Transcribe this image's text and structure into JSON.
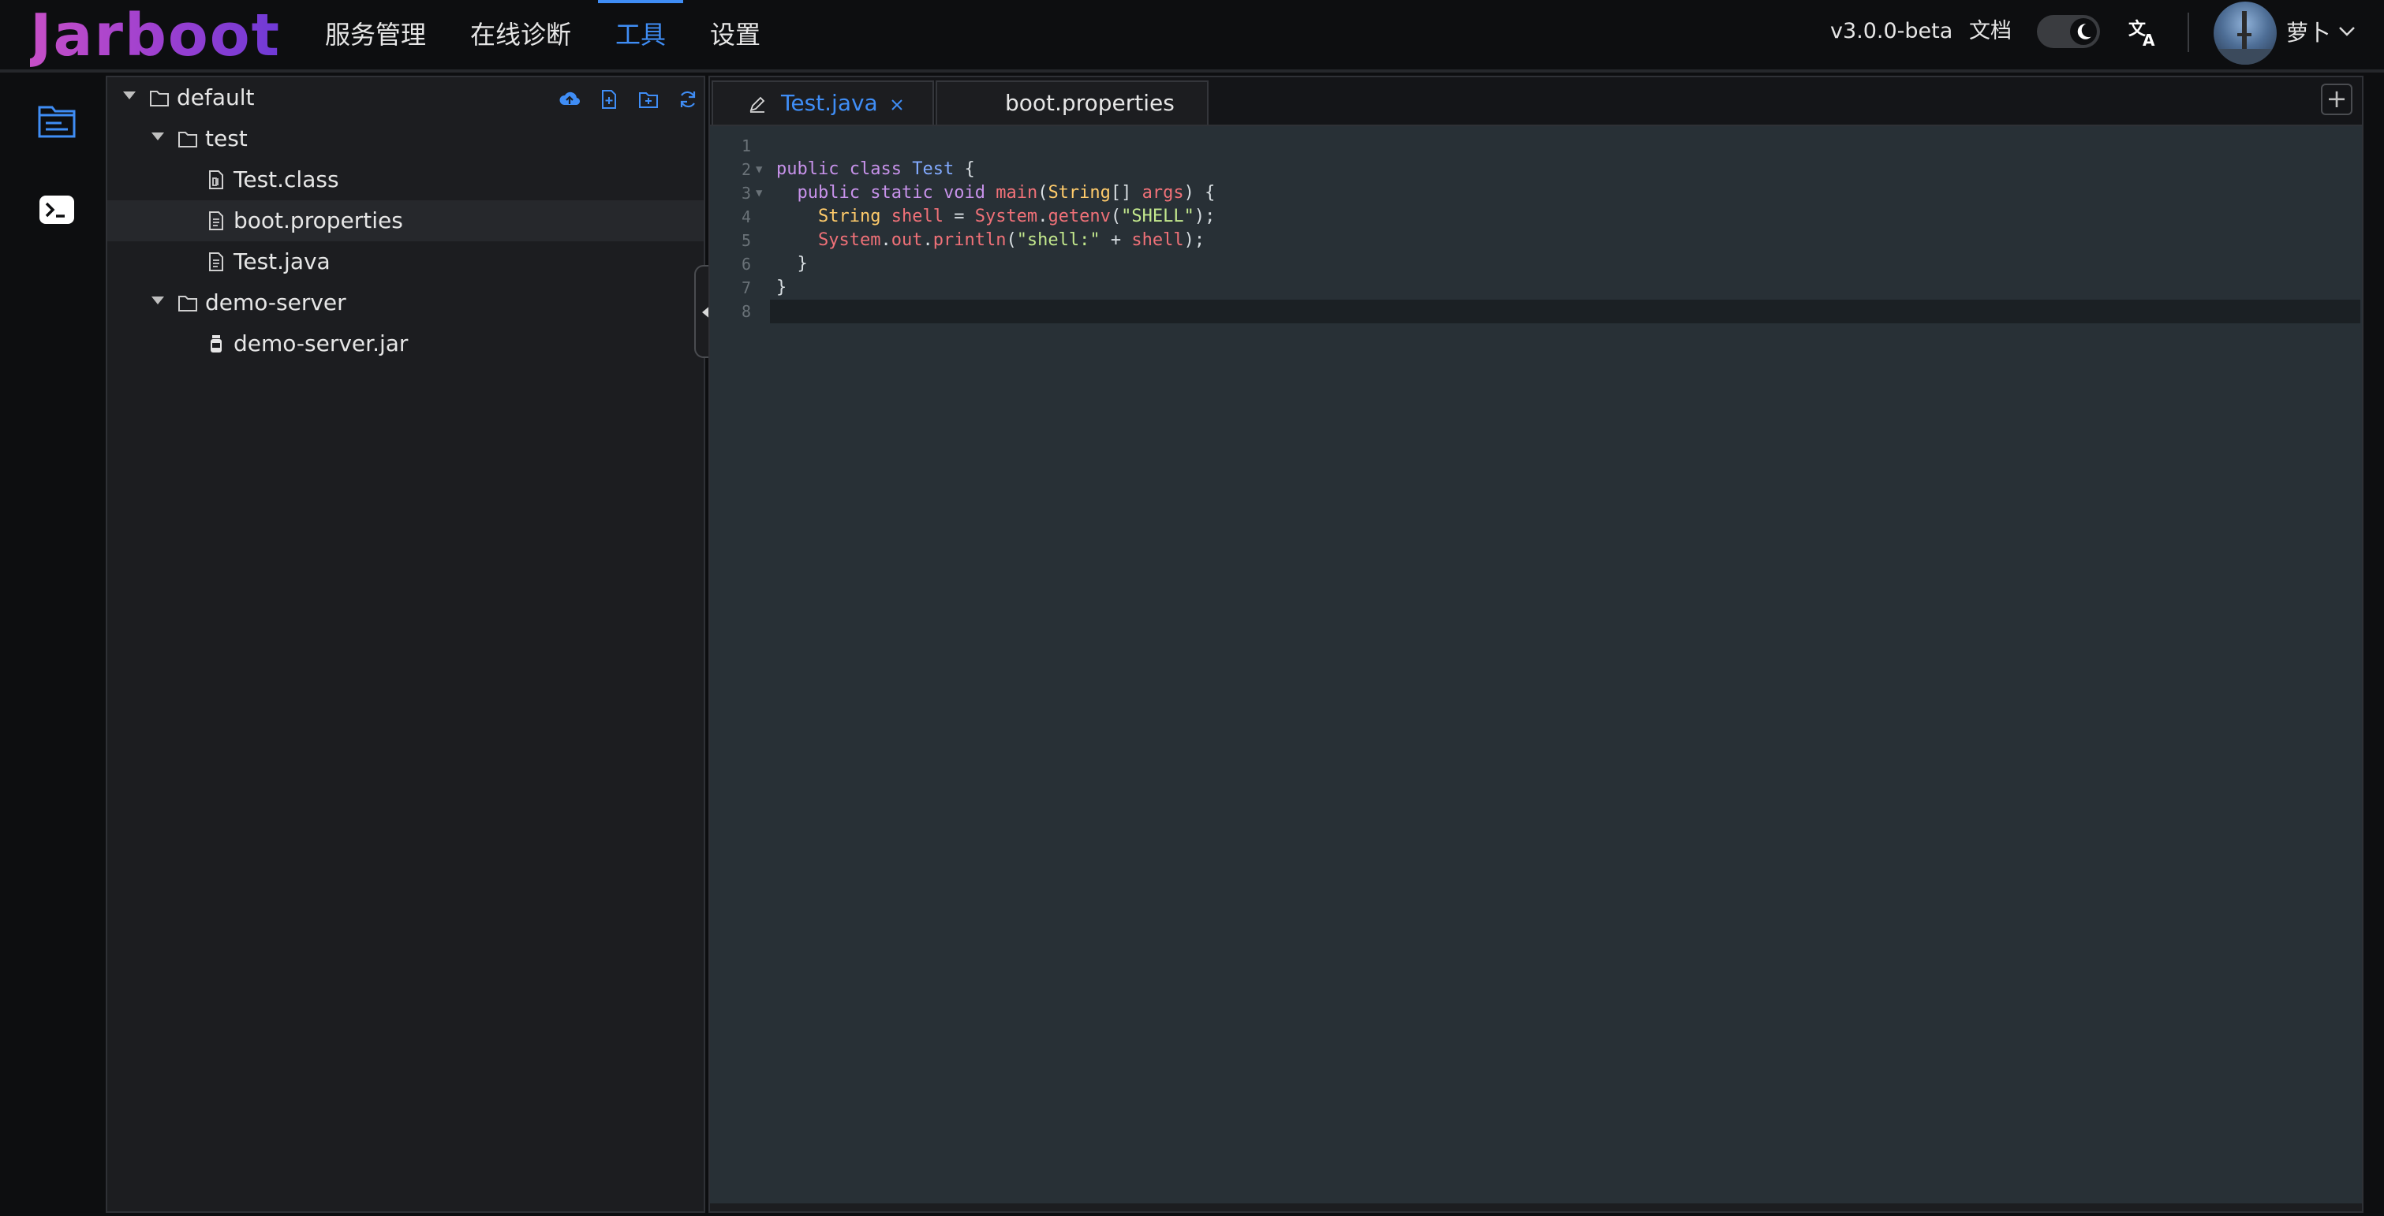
{
  "app": {
    "logo": "Jarboot"
  },
  "nav": {
    "items": [
      {
        "label": "服务管理",
        "active": false
      },
      {
        "label": "在线诊断",
        "active": false
      },
      {
        "label": "工具",
        "active": true
      },
      {
        "label": "设置",
        "active": false
      }
    ]
  },
  "header": {
    "version": "v3.0.0-beta",
    "docs_label": "文档",
    "theme_icon": "moon-icon",
    "lang_icon": "translate-icon",
    "user_name": "萝卜"
  },
  "rail": {
    "items": [
      {
        "name": "file-manager-icon",
        "active": true
      },
      {
        "name": "terminal-icon",
        "active": false
      }
    ]
  },
  "tree": {
    "root": "default",
    "toolbar": [
      "upload-icon",
      "new-file-icon",
      "new-folder-icon",
      "refresh-icon"
    ],
    "nodes": [
      {
        "label": "test",
        "type": "folder"
      },
      {
        "label": "Test.class",
        "type": "file"
      },
      {
        "label": "boot.properties",
        "type": "file",
        "selected": true
      },
      {
        "label": "Test.java",
        "type": "file"
      },
      {
        "label": "demo-server",
        "type": "folder"
      },
      {
        "label": "demo-server.jar",
        "type": "jar"
      }
    ]
  },
  "editor": {
    "tabs": [
      {
        "label": "Test.java",
        "active": true,
        "modified": true
      },
      {
        "label": "boot.properties",
        "active": false
      }
    ],
    "add_tab_label": "+",
    "lines": [
      {
        "n": "1",
        "text": ""
      },
      {
        "n": "2",
        "text": "public class Test {"
      },
      {
        "n": "3",
        "text": "  public static void main(String[] args) {"
      },
      {
        "n": "4",
        "text": "    String shell = System.getenv(\"SHELL\");"
      },
      {
        "n": "5",
        "text": "    System.out.println(\"shell:\" + shell);"
      },
      {
        "n": "6",
        "text": "  }"
      },
      {
        "n": "7",
        "text": "}"
      },
      {
        "n": "8",
        "text": ""
      }
    ]
  }
}
